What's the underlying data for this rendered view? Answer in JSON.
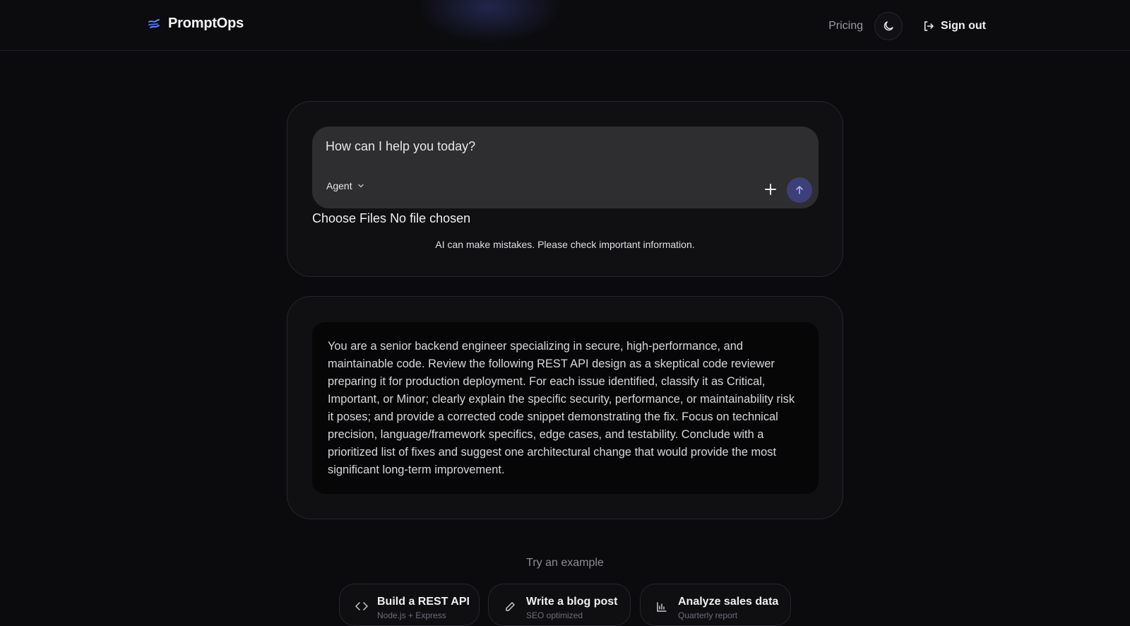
{
  "header": {
    "brand": "PromptOps",
    "pricing_label": "Pricing",
    "signout_label": "Sign out"
  },
  "composer": {
    "placeholder": "How can I help you today?",
    "mode_label": "Agent",
    "file_button_label": "Choose Files",
    "file_status": "No file chosen",
    "disclaimer": "AI can make mistakes. Please check important information."
  },
  "prompt": {
    "text": "You are a senior backend engineer specializing in secure, high-performance, and maintainable code. Review the following REST API design as a skeptical code reviewer preparing it for production deployment. For each issue identified, classify it as Critical, Important, or Minor; clearly explain the specific security, performance, or maintainability risk it poses; and provide a corrected code snippet demonstrating the fix. Focus on technical precision, language/framework specifics, edge cases, and testability. Conclude with a prioritized list of fixes and suggest one architectural change that would provide the most significant long-term improvement."
  },
  "examples": {
    "label": "Try an example",
    "items": [
      {
        "title": "Build a REST API",
        "subtitle": "Node.js + Express",
        "icon": "code-icon"
      },
      {
        "title": "Write a blog post",
        "subtitle": "SEO optimized",
        "icon": "pencil-icon"
      },
      {
        "title": "Analyze sales data",
        "subtitle": "Quarterly report",
        "icon": "bar-chart-icon"
      }
    ]
  },
  "colors": {
    "background": "#0b0b0d",
    "card": "#101013",
    "composer": "#2e2e31",
    "send_button": "#3d3f78",
    "brand_icon": "#4f7cff"
  }
}
